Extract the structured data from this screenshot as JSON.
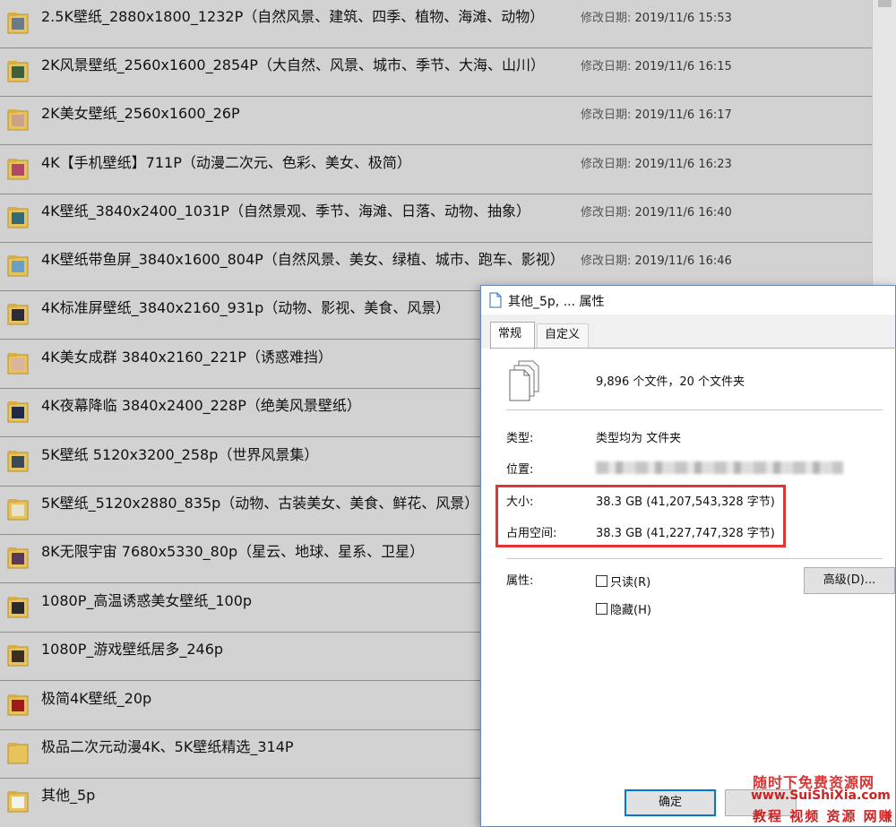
{
  "file_list": {
    "date_prefix": "修改日期:",
    "rows": [
      {
        "name": "2.5K壁纸_2880x1800_1232P（自然风景、建筑、四季、植物、海滩、动物）",
        "date": "2019/11/6 15:53"
      },
      {
        "name": "2K风景壁纸_2560x1600_2854P（大自然、风景、城市、季节、大海、山川）",
        "date": "2019/11/6 16:15"
      },
      {
        "name": "2K美女壁纸_2560x1600_26P",
        "date": "2019/11/6 16:17"
      },
      {
        "name": "4K【手机壁纸】711P（动漫二次元、色彩、美女、极简）",
        "date": "2019/11/6 16:23"
      },
      {
        "name": "4K壁纸_3840x2400_1031P（自然景观、季节、海滩、日落、动物、抽象）",
        "date": "2019/11/6 16:40"
      },
      {
        "name": "4K壁纸带鱼屏_3840x1600_804P（自然风景、美女、绿植、城市、跑车、影视）",
        "date": "2019/11/6 16:46"
      },
      {
        "name": "4K标准屏壁纸_3840x2160_931p（动物、影视、美食、风景）",
        "date": ""
      },
      {
        "name": "4K美女成群 3840x2160_221P（诱惑难挡）",
        "date": ""
      },
      {
        "name": "4K夜幕降临 3840x2400_228P（绝美风景壁纸）",
        "date": ""
      },
      {
        "name": "5K壁纸 5120x3200_258p（世界风景集）",
        "date": ""
      },
      {
        "name": "5K壁纸_5120x2880_835p（动物、古装美女、美食、鲜花、风景）",
        "date": ""
      },
      {
        "name": "8K无限宇宙 7680x5330_80p（星云、地球、星系、卫星）",
        "date": ""
      },
      {
        "name": "1080P_高温诱惑美女壁纸_100p",
        "date": ""
      },
      {
        "name": "1080P_游戏壁纸居多_246p",
        "date": ""
      },
      {
        "name": "极简4K壁纸_20p",
        "date": ""
      },
      {
        "name": "极品二次元动漫4K、5K壁纸精选_314P",
        "date": ""
      },
      {
        "name": "其他_5p",
        "date": ""
      }
    ]
  },
  "dialog": {
    "title": "其他_5p, ... 属性",
    "tabs": [
      "常规",
      "自定义"
    ],
    "contents_summary": "9,896 个文件，20 个文件夹",
    "type_label": "类型:",
    "type_value": "类型均为 文件夹",
    "location_label": "位置:",
    "size_label": "大小:",
    "size_value": "38.3 GB (41,207,543,328 字节)",
    "size_on_disk_label": "占用空间:",
    "size_on_disk_value": "38.3 GB (41,227,747,328 字节)",
    "attributes_label": "属性:",
    "readonly_label": "只读(R)",
    "hidden_label": "隐藏(H)",
    "advanced_button": "高级(D)...",
    "ok_button": "确定"
  },
  "watermark": {
    "line1": "随时下免费资源网",
    "line2": "www.SuiShiXia.com",
    "line3": "教程 视频 资源 网赚"
  },
  "colors": {
    "highlight_box": "#e53333",
    "folder_yellow": "#e8c25a",
    "primary_button_border": "#0078d7"
  }
}
